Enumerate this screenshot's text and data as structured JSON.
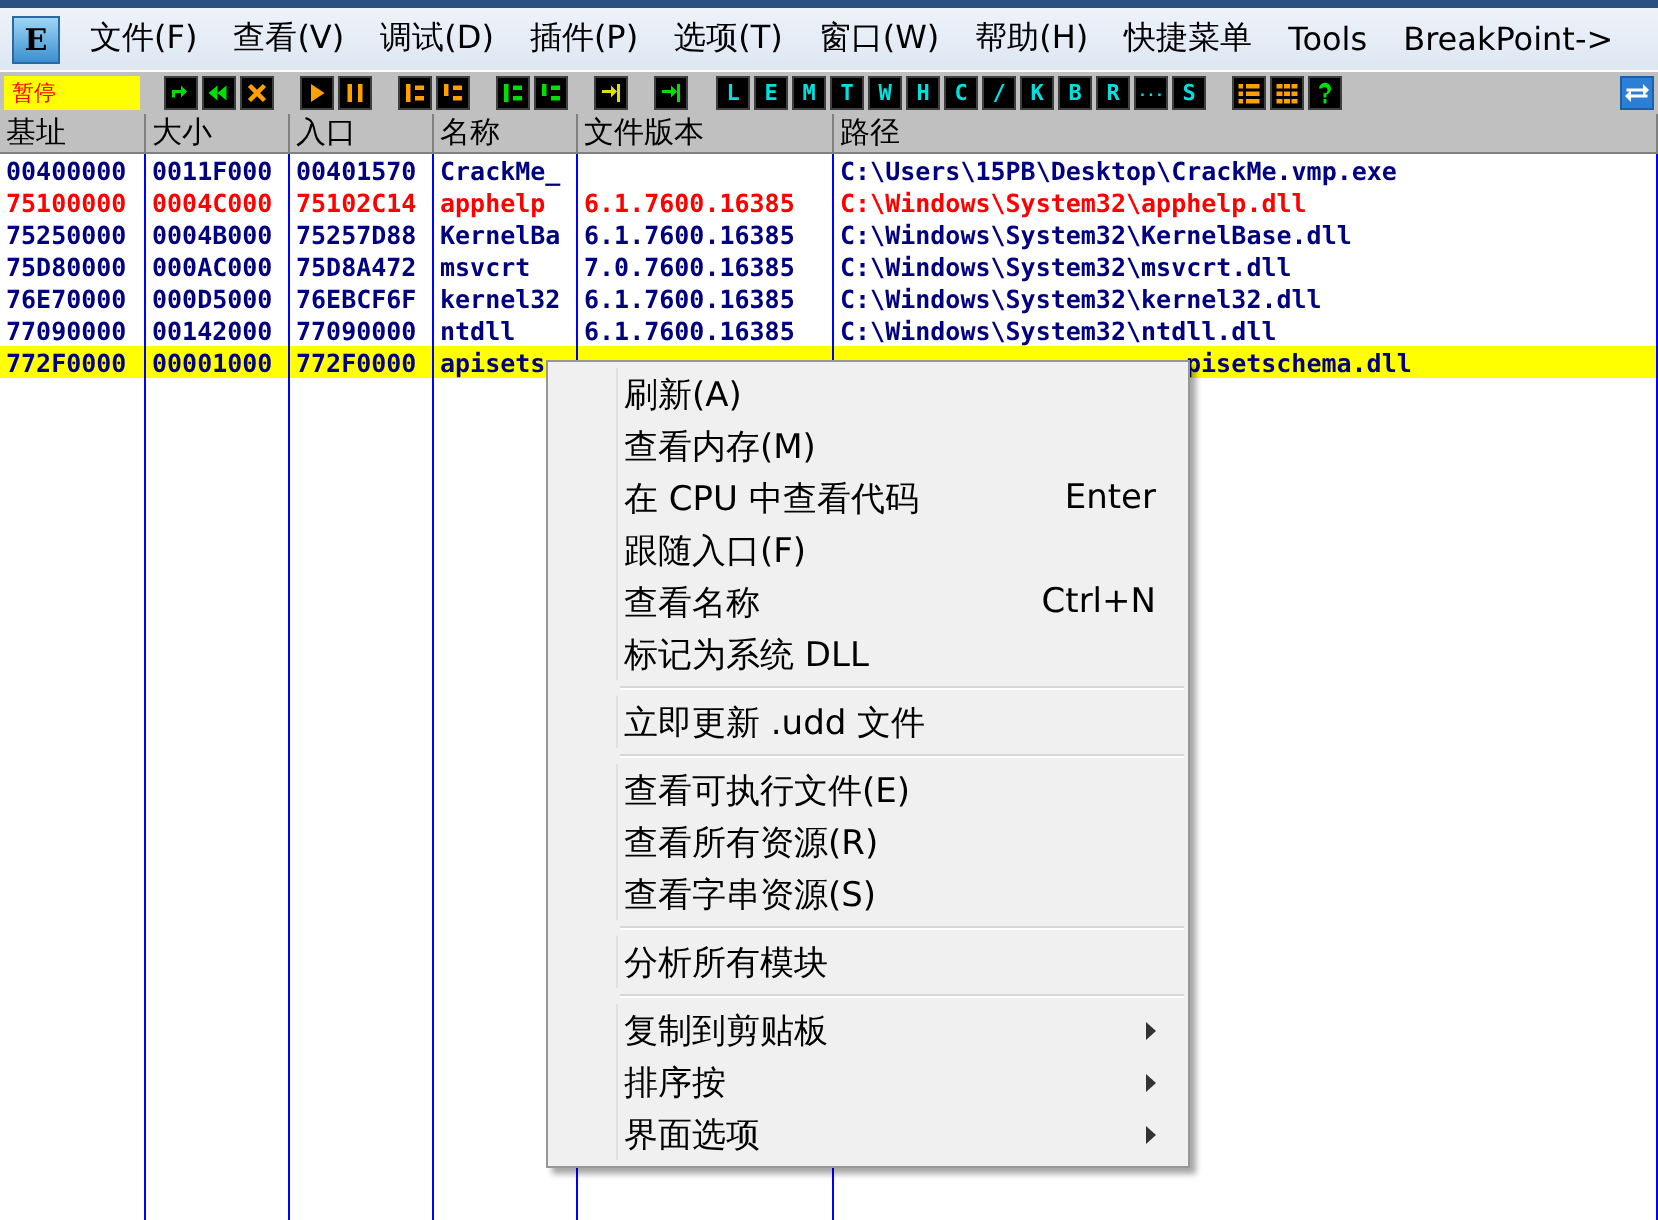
{
  "app_icon": "E",
  "menu_bar": [
    "文件(F)",
    "查看(V)",
    "调试(D)",
    "插件(P)",
    "选项(T)",
    "窗口(W)",
    "帮助(H)",
    "快捷菜单",
    "Tools",
    "BreakPoint->"
  ],
  "status": "暂停",
  "letter_buttons": [
    "L",
    "E",
    "M",
    "T",
    "W",
    "H",
    "C",
    "/",
    "K",
    "B",
    "R",
    "...",
    "S"
  ],
  "table": {
    "columns": [
      "基址",
      "大小",
      "入口",
      "名称",
      "文件版本",
      "路径"
    ],
    "rows": [
      {
        "base": "00400000",
        "size": "0011F000",
        "entry": "00401570",
        "name": "CrackMe_",
        "path": "C:\\Users\\15PB\\Desktop\\CrackMe.vmp.exe",
        "highlighted": false,
        "selected": false
      },
      {
        "base": "75100000",
        "size": "0004C000",
        "entry": "75102C14",
        "name": "apphelp",
        "version": "6.1.7600.16385",
        "path": "C:\\Windows\\System32\\apphelp.dll",
        "highlighted": true,
        "selected": false
      },
      {
        "base": "75250000",
        "size": "0004B000",
        "entry": "75257D88",
        "name": "KernelBa",
        "version": "6.1.7600.16385",
        "path": "C:\\Windows\\System32\\KernelBase.dll",
        "highlighted": false,
        "selected": false
      },
      {
        "base": "75D80000",
        "size": "000AC000",
        "entry": "75D8A472",
        "name": "msvcrt",
        "version": "7.0.7600.16385",
        "path": "C:\\Windows\\System32\\msvcrt.dll",
        "highlighted": false,
        "selected": false
      },
      {
        "base": "76E70000",
        "size": "000D5000",
        "entry": "76EBCF6F",
        "name": "kernel32",
        "version": "6.1.7600.16385",
        "path": "C:\\Windows\\System32\\kernel32.dll",
        "highlighted": false,
        "selected": false
      },
      {
        "base": "77090000",
        "size": "00142000",
        "entry": "77090000",
        "name": "ntdll",
        "version": "6.1.7600.16385",
        "path": "C:\\Windows\\System32\\ntdll.dll",
        "highlighted": false,
        "selected": false
      },
      {
        "base": "772F0000",
        "size": "00001000",
        "entry": "772F0000",
        "name": "apisets",
        "path": "pisetschema.dll",
        "path_covered": true,
        "highlighted": false,
        "selected": true
      }
    ]
  },
  "context_menu": [
    {
      "kind": "item",
      "label": "刷新(A)"
    },
    {
      "kind": "item",
      "label": "查看内存(M)"
    },
    {
      "kind": "item",
      "label": "在 CPU 中查看代码",
      "shortcut": "Enter"
    },
    {
      "kind": "item",
      "label": "跟随入口(F)"
    },
    {
      "kind": "item",
      "label": "查看名称",
      "shortcut": "Ctrl+N"
    },
    {
      "kind": "item",
      "label": "标记为系统 DLL"
    },
    {
      "kind": "separator"
    },
    {
      "kind": "item",
      "label": "立即更新 .udd 文件"
    },
    {
      "kind": "separator"
    },
    {
      "kind": "item",
      "label": "查看可执行文件(E)"
    },
    {
      "kind": "item",
      "label": "查看所有资源(R)"
    },
    {
      "kind": "item",
      "label": "查看字串资源(S)"
    },
    {
      "kind": "separator"
    },
    {
      "kind": "item",
      "label": "分析所有模块"
    },
    {
      "kind": "separator"
    },
    {
      "kind": "submenu",
      "label": "复制到剪贴板"
    },
    {
      "kind": "submenu",
      "label": "排序按"
    },
    {
      "kind": "submenu",
      "label": "界面选项"
    }
  ]
}
